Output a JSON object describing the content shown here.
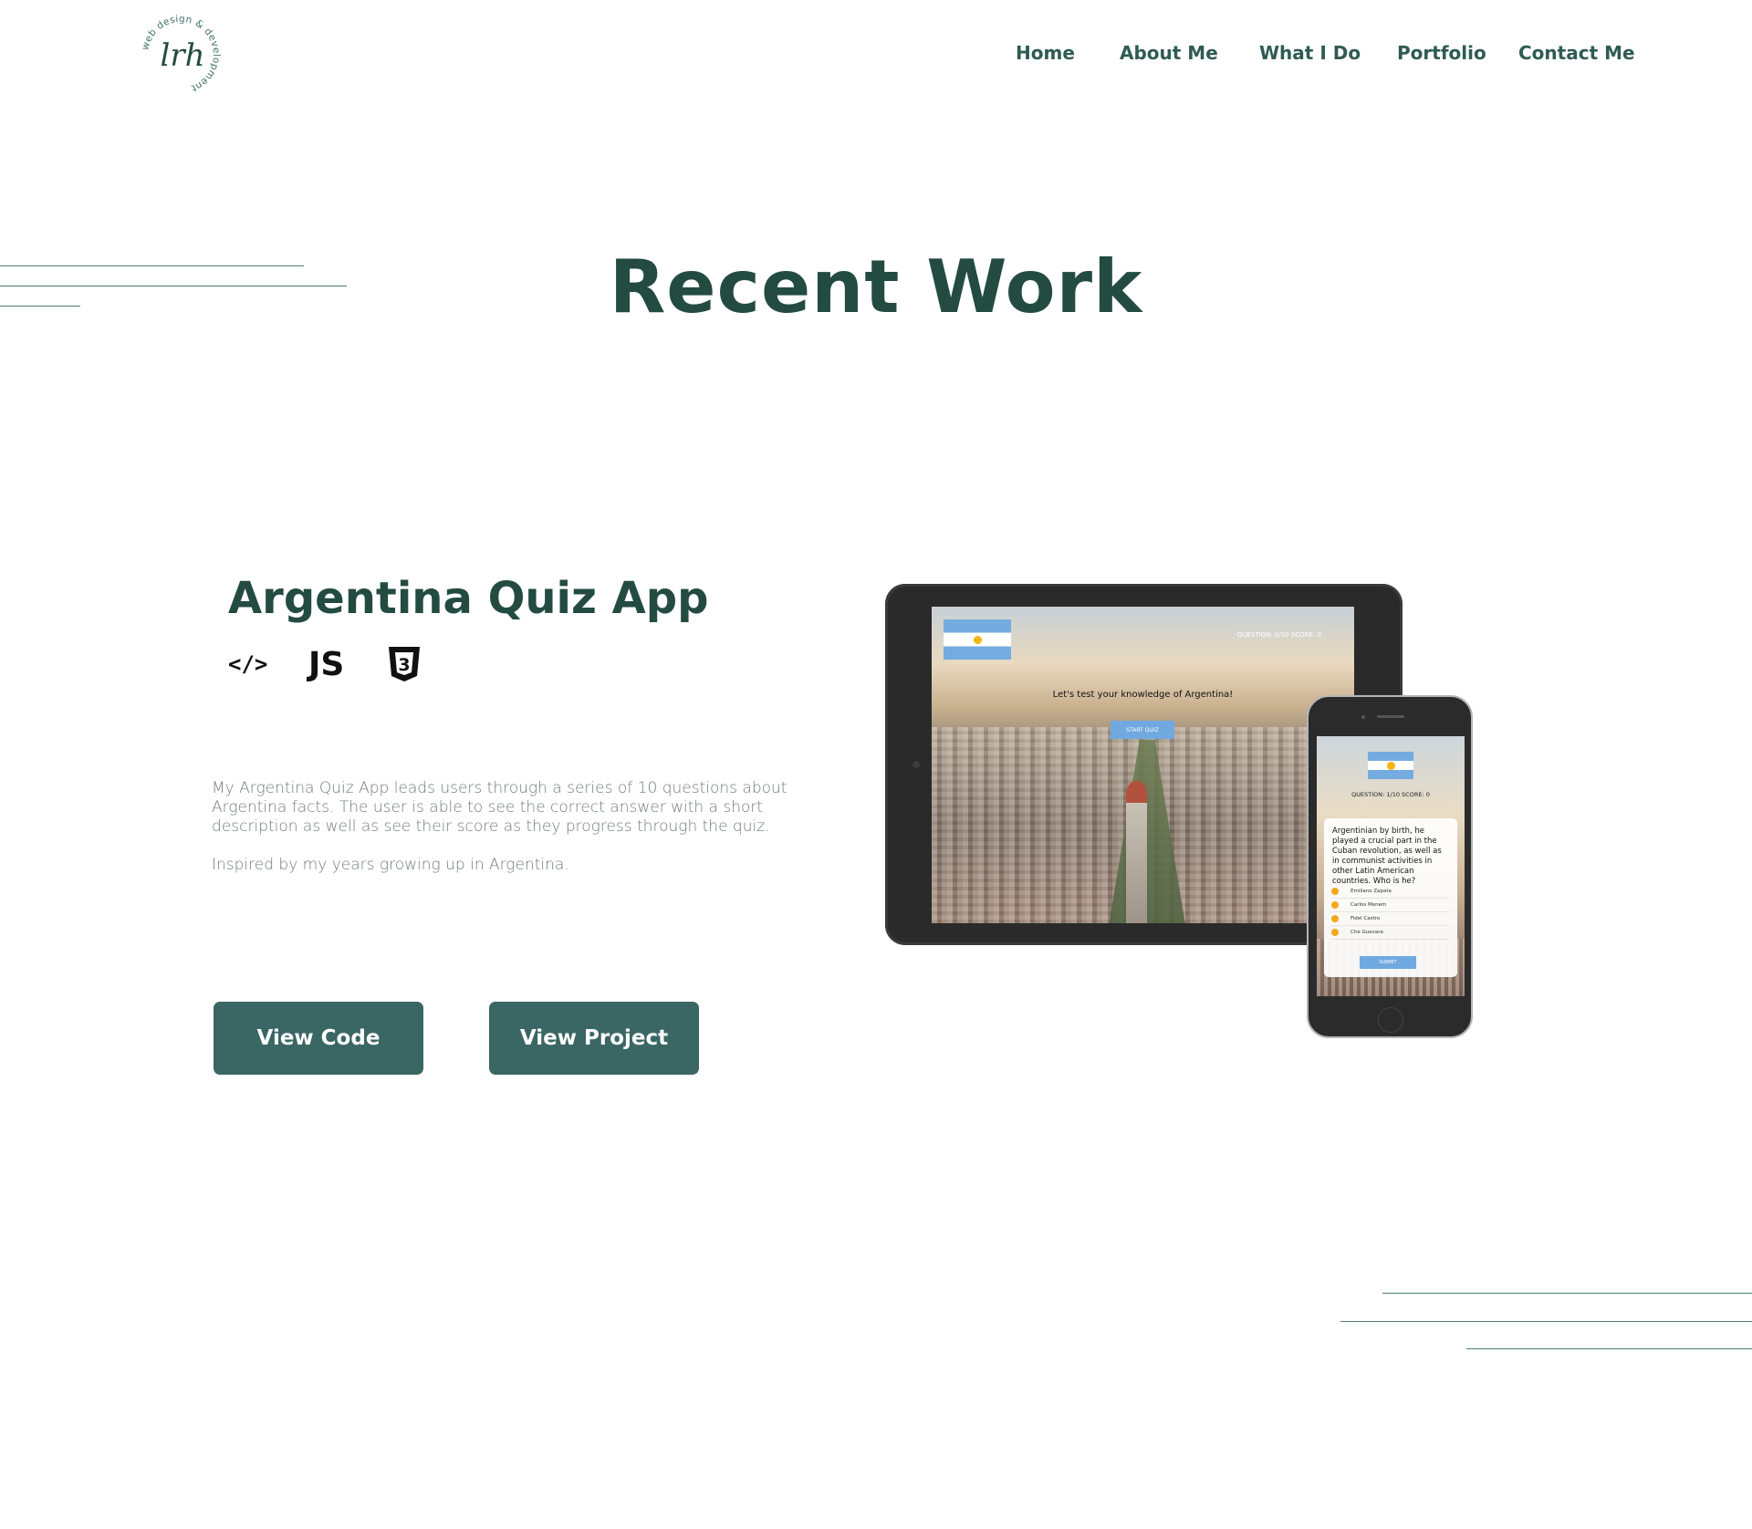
{
  "logo": {
    "monogram": "lrh",
    "ring_text": "web design & development"
  },
  "nav": {
    "items": [
      {
        "label": "Home"
      },
      {
        "label": "About Me"
      },
      {
        "label": "What I Do"
      },
      {
        "label": "Portfolio"
      },
      {
        "label": "Contact Me"
      }
    ]
  },
  "section": {
    "title": "Recent Work"
  },
  "project": {
    "title": "Argentina Quiz App",
    "tech_icons": [
      {
        "icon": "html-icon",
        "label": "</>"
      },
      {
        "icon": "javascript-icon",
        "label": "JS"
      },
      {
        "icon": "css3-icon",
        "label": "3"
      }
    ],
    "description": [
      "My Argentina Quiz App leads users through a series of 10 questions about Argentina facts. The user is able to see the correct answer with a short description as well as see their score as they progress through the quiz.",
      "Inspired by my years growing up in Argentina."
    ],
    "buttons": {
      "view_code": "View Code",
      "view_project": "View Project"
    }
  },
  "mockup": {
    "tablet": {
      "hud": "QUESTION: 0/10     SCORE: 0",
      "prompt": "Let's test your knowledge of Argentina!",
      "start_button": "START QUIZ"
    },
    "phone": {
      "hud": "QUESTION: 1/10     SCORE: 0",
      "question": "Argentinian by birth, he played a crucial part in the Cuban revolution, as well as in communist activities in other Latin American countries. Who is he?",
      "answers": [
        "Emiliano Zapata",
        "Carlos Menem",
        "Fidel Castro",
        "Che Guevara"
      ],
      "submit_button": "SUBMIT"
    }
  },
  "colors": {
    "brand_dark": "#234b42",
    "nav_text": "#2f5b53",
    "button_bg": "#3a6664",
    "description_text": "#6f7d79",
    "decorative_line": "#4f7d72"
  }
}
